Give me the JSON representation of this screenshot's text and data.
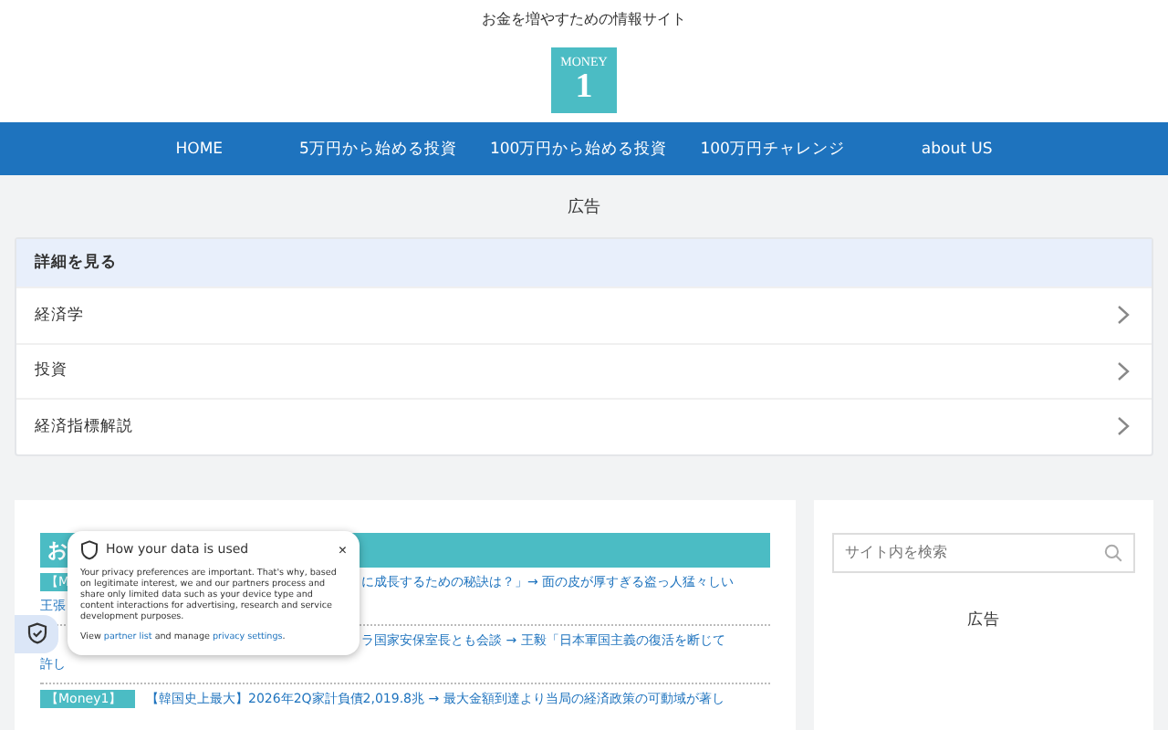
{
  "header": {
    "tagline": "お金を増やすための情報サイト",
    "logo": {
      "word": "MONEY",
      "digit": "1"
    }
  },
  "nav": [
    "HOME",
    "5万円から始める投資",
    "100万円から始める投資",
    "100万円チャレンジ",
    "about US"
  ],
  "ad_label": "広告",
  "accordion": {
    "title": "詳細を見る",
    "items": [
      "経済学",
      "投資",
      "経済指標解説"
    ]
  },
  "news": {
    "heading": "お",
    "rows": [
      {
        "tag": "【M",
        "lines": [
          "に成長するための秘訣は？」→ 面の皮が厚すぎる盗っ人猛々しい",
          "王張"
        ]
      },
      {
        "tag": "",
        "lines": [
          "ラ国家安保室長とも会談 → 王毅「日本軍国主義の復活を断じて",
          "許し"
        ]
      },
      {
        "tag": "【Money1】",
        "lines": [
          "【韓国史上最大】2026年2Q家計負債2,019.8兆 → 最大金額到達より当局の経済政策の可動域が著し"
        ]
      }
    ]
  },
  "privacy": {
    "title": "How your data is used",
    "close": "×",
    "body": "Your privacy preferences are important. That's why, based on legitimate interest, we and our partners process and share only limited data such as your device type and content interactions for advertising, research and service development purposes.",
    "view": "View",
    "partner_link": "partner list",
    "middle": "and manage",
    "settings_link": "privacy settings",
    "end": "."
  },
  "sidebar": {
    "search": {
      "placeholder": "サイト内を検索"
    },
    "ad_label": "広告"
  }
}
